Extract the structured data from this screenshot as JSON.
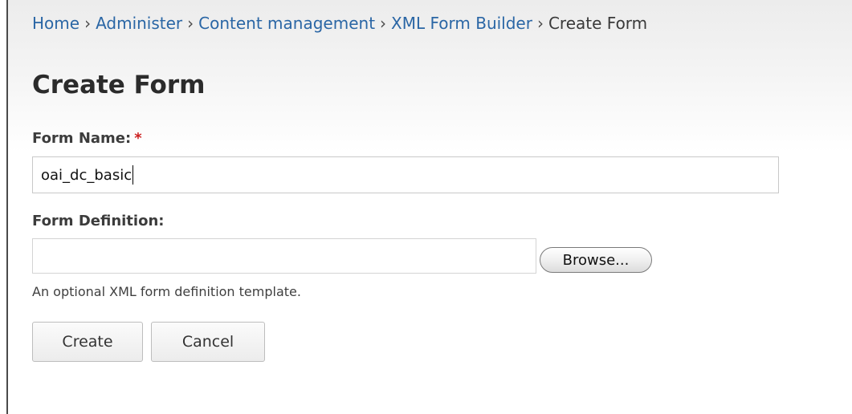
{
  "breadcrumb": {
    "items": [
      "Home",
      "Administer",
      "Content management",
      "XML Form Builder"
    ],
    "separator": "›",
    "current": "Create Form"
  },
  "page": {
    "title": "Create Form"
  },
  "form": {
    "name_label": "Form Name:",
    "required_marker": "*",
    "name_value": "oai_dc_basic",
    "definition_label": "Form Definition:",
    "file_value": "",
    "browse_label": "Browse...",
    "definition_help": "An optional XML form definition template.",
    "create_label": "Create",
    "cancel_label": "Cancel"
  },
  "colors": {
    "link": "#2a66a5",
    "required": "#cc1f1f",
    "header_bg": "#ececec"
  }
}
